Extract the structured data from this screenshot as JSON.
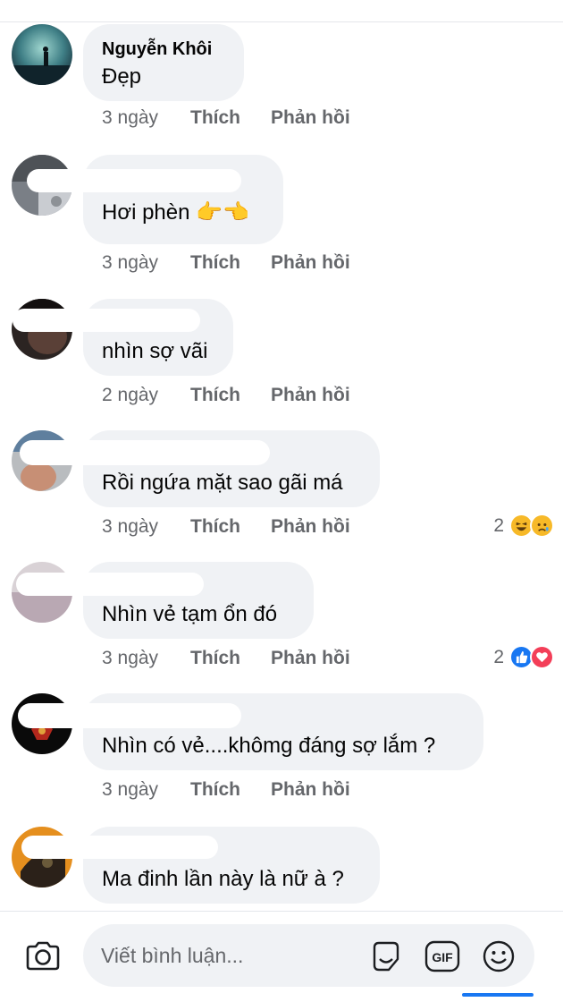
{
  "comments": [
    {
      "name": "Nguyễn Khôi",
      "text": "Đẹp",
      "time": "3 ngày",
      "like": "Thích",
      "reply": "Phản hồi"
    },
    {
      "name": "",
      "text": "Hơi phèn 👉👈",
      "time": "3 ngày",
      "like": "Thích",
      "reply": "Phản hồi"
    },
    {
      "name": "",
      "text": "nhìn sợ vãi",
      "time": "2 ngày",
      "like": "Thích",
      "reply": "Phản hồi"
    },
    {
      "name": "",
      "text": "Rồi ngứa mặt sao gãi má",
      "time": "3 ngày",
      "like": "Thích",
      "reply": "Phản hồi",
      "reaction_count": "2",
      "reactions": [
        "laugh-icon",
        "sad-icon"
      ]
    },
    {
      "name": "",
      "text": "Nhìn vẻ tạm ổn đó",
      "time": "3 ngày",
      "like": "Thích",
      "reply": "Phản hồi",
      "reaction_count": "2",
      "reactions": [
        "like-icon",
        "love-icon"
      ]
    },
    {
      "name": "",
      "text": "Nhìn có vẻ....khômg đáng sợ lắm ?",
      "time": "3 ngày",
      "like": "Thích",
      "reply": "Phản hồi"
    },
    {
      "name": "",
      "text": "Ma đinh lần này là nữ à ?",
      "time": "",
      "like": "",
      "reply": ""
    }
  ],
  "composer": {
    "placeholder": "Viết bình luận...",
    "icons": [
      "camera-icon",
      "sticker-icon",
      "gif-icon",
      "emoji-icon"
    ],
    "gif_label": "GIF"
  },
  "colors": {
    "bubble": "#f0f2f5",
    "meta": "#65676b",
    "like_blue": "#1877f2",
    "love_red": "#f33e58",
    "haha_yellow": "#f7b928"
  }
}
